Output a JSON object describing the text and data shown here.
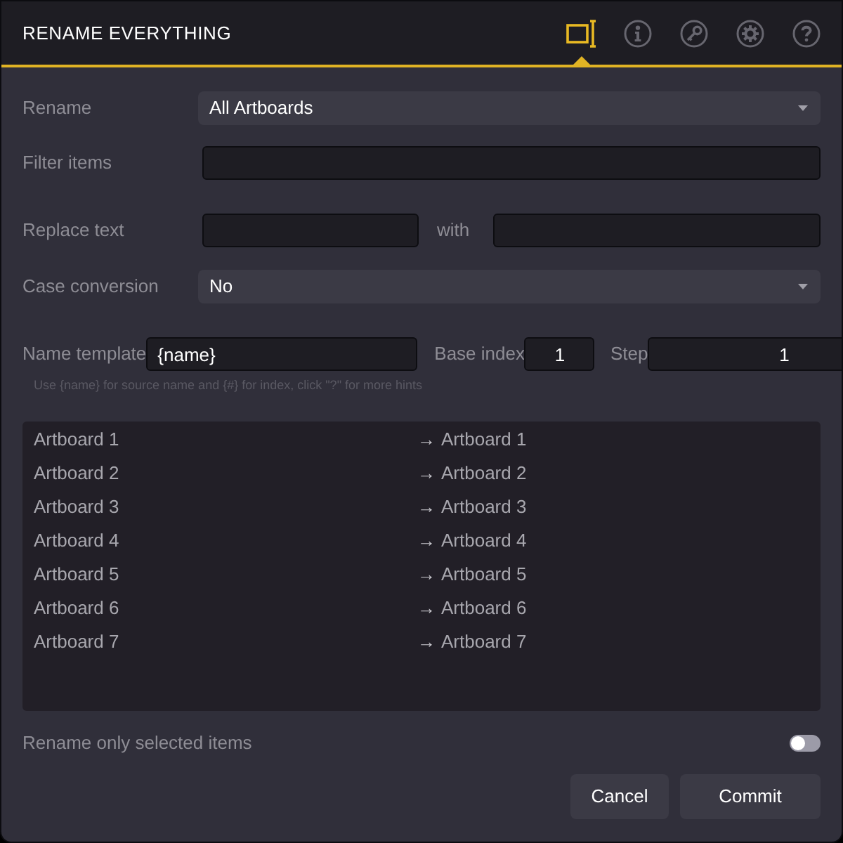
{
  "window": {
    "title": "RENAME EVERYTHING"
  },
  "tabs": [
    {
      "kind": "rename",
      "selected": true
    },
    {
      "kind": "info",
      "selected": false
    },
    {
      "kind": "key",
      "selected": false
    },
    {
      "kind": "settings",
      "selected": false
    },
    {
      "kind": "help",
      "selected": false
    }
  ],
  "rename": {
    "label": "Rename",
    "value": "All Artboards"
  },
  "filter": {
    "label": "Filter items"
  },
  "replace": {
    "label": "Replace text",
    "with_label": "with"
  },
  "case_conversion": {
    "label": "Case conversion",
    "value": "No"
  },
  "name_template": {
    "label": "Name template",
    "value": "{name}",
    "base_index_label": "Base index",
    "base_index": "1",
    "step_label": "Step",
    "step": "1",
    "hint": "Use {name} for source name and {#} for index, click \"?\" for more hints"
  },
  "preview": {
    "rows": [
      {
        "source": "Artboard 1",
        "arrow": "→",
        "target": "Artboard 1"
      },
      {
        "source": "Artboard 2",
        "arrow": "→",
        "target": "Artboard 2"
      },
      {
        "source": "Artboard 3",
        "arrow": "→",
        "target": "Artboard 3"
      },
      {
        "source": "Artboard 4",
        "arrow": "→",
        "target": "Artboard 4"
      },
      {
        "source": "Artboard 5",
        "arrow": "→",
        "target": "Artboard 5"
      },
      {
        "source": "Artboard 6",
        "arrow": "→",
        "target": "Artboard 6"
      },
      {
        "source": "Artboard 7",
        "arrow": "→",
        "target": "Artboard 7"
      }
    ]
  },
  "selected_only": {
    "label": "Rename only selected items",
    "on": false
  },
  "buttons": [
    "Cancel",
    "Commit"
  ]
}
